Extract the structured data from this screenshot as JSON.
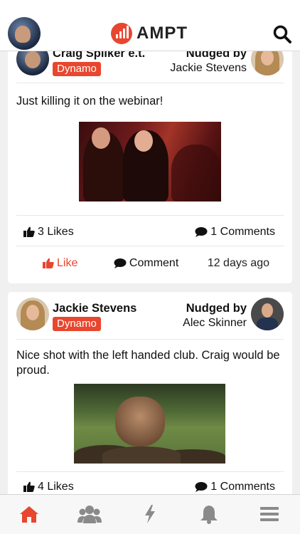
{
  "header": {
    "logo_text": "AMPT",
    "avatar_icon": "user-avatar",
    "search_icon": "search-icon"
  },
  "posts": [
    {
      "author": "Craig Spilker e.t.",
      "badge": "Dynamo",
      "nudged_by_label": "Nudged by",
      "nudged_by": "Jackie Stevens",
      "text": "Just killing it on the webinar!",
      "likes": "3 Likes",
      "comments": "1 Comments",
      "like_label": "Like",
      "comment_label": "Comment",
      "time": "12 days ago"
    },
    {
      "author": "Jackie Stevens",
      "badge": "Dynamo",
      "nudged_by_label": "Nudged by",
      "nudged_by": "Alec Skinner",
      "text": "Nice shot with the left handed club. Craig would be proud.",
      "likes": "4 Likes",
      "comments": "1 Comments"
    }
  ],
  "tabs": [
    {
      "name": "home",
      "icon": "home-icon",
      "active": true
    },
    {
      "name": "team",
      "icon": "group-icon",
      "active": false
    },
    {
      "name": "activity",
      "icon": "bolt-icon",
      "active": false
    },
    {
      "name": "notifications",
      "icon": "bell-icon",
      "active": false
    },
    {
      "name": "menu",
      "icon": "hamburger-icon",
      "active": false
    }
  ],
  "colors": {
    "accent": "#e8462e",
    "icon_gray": "#8a8a8a",
    "text": "#111111"
  }
}
